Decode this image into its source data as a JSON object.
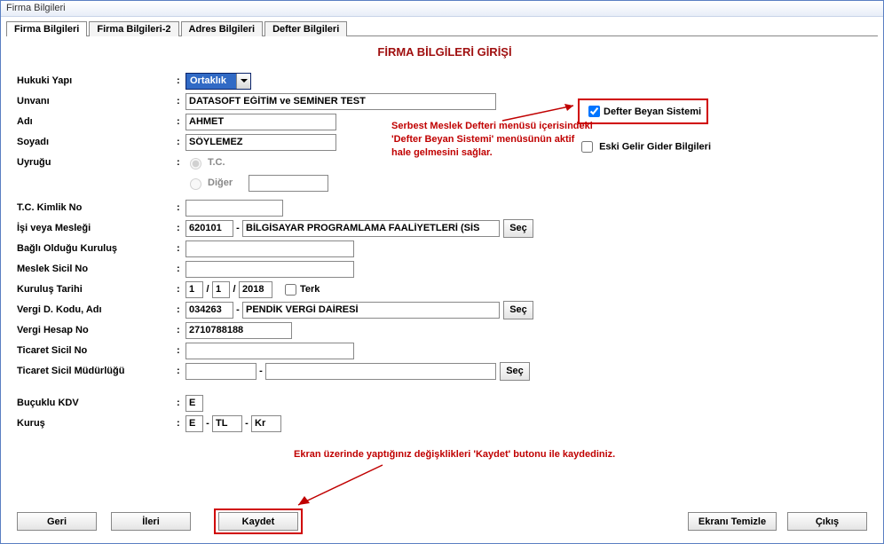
{
  "window": {
    "title": "Firma Bilgileri"
  },
  "tabs": [
    {
      "label": "Firma Bilgileri"
    },
    {
      "label": "Firma Bilgileri-2"
    },
    {
      "label": "Adres Bilgileri"
    },
    {
      "label": "Defter Bilgileri"
    }
  ],
  "heading": "FİRMA BİLGİLERİ GİRİŞİ",
  "labels": {
    "hukuki_yapi": "Hukuki Yapı",
    "unvani": "Unvanı",
    "adi": "Adı",
    "soyadi": "Soyadı",
    "uyrugu": "Uyruğu",
    "tc_kimlik": "T.C. Kimlik No",
    "isi": "İşi veya Mesleği",
    "bagli": "Bağlı Olduğu Kuruluş",
    "meslek_sicil": "Meslek Sicil No",
    "kurulus": "Kuruluş Tarihi",
    "vergi_d": "Vergi D. Kodu, Adı",
    "vergi_hesap": "Vergi Hesap No",
    "ticaret_sicil": "Ticaret Sicil No",
    "ticaret_mud": "Ticaret Sicil Müdürlüğü",
    "bucuklu_kdv": "Buçuklu KDV",
    "kurus": "Kuruş",
    "terk": "Terk",
    "tc_radio": "T.C.",
    "diger_radio": "Diğer"
  },
  "values": {
    "hukuki_yapi": "Ortaklık",
    "unvani": "DATASOFT EĞİTİM ve SEMİNER TEST",
    "adi": "AHMET",
    "soyadi": "SÖYLEMEZ",
    "tc_kimlik": "",
    "isi_kodu": "620101",
    "isi_ad": "BİLGİSAYAR PROGRAMLAMA FAALİYETLERİ (SİS",
    "bagli": "",
    "meslek_sicil": "",
    "kurulus_g": "1",
    "kurulus_a": "1",
    "kurulus_y": "2018",
    "vergi_d_kod": "034263",
    "vergi_d_ad": "PENDİK VERGİ DAİRESİ",
    "vergi_hesap": "2710788188",
    "ticaret_sicil": "",
    "ticaret_mud_kod": "",
    "ticaret_mud_ad": "",
    "bucuklu_kdv": "E",
    "kurus_a": "E",
    "kurus_b": "TL",
    "kurus_c": "Kr"
  },
  "right": {
    "defter_beyan": "Defter Beyan Sistemi",
    "eski_gelir": "Eski Gelir Gider Bilgileri"
  },
  "annotations": {
    "a1": "Serbest Meslek Defteri menüsü içerisindeki 'Defter Beyan Sistemi' menüsünün aktif hale gelmesini sağlar.",
    "a2": "Ekran üzerinde yaptığınız değişklikleri 'Kaydet' butonu ile kaydediniz."
  },
  "buttons": {
    "geri": "Geri",
    "ileri": "İleri",
    "kaydet": "Kaydet",
    "ekrani_temizle": "Ekranı Temizle",
    "cikis": "Çıkış",
    "sec": "Seç"
  }
}
